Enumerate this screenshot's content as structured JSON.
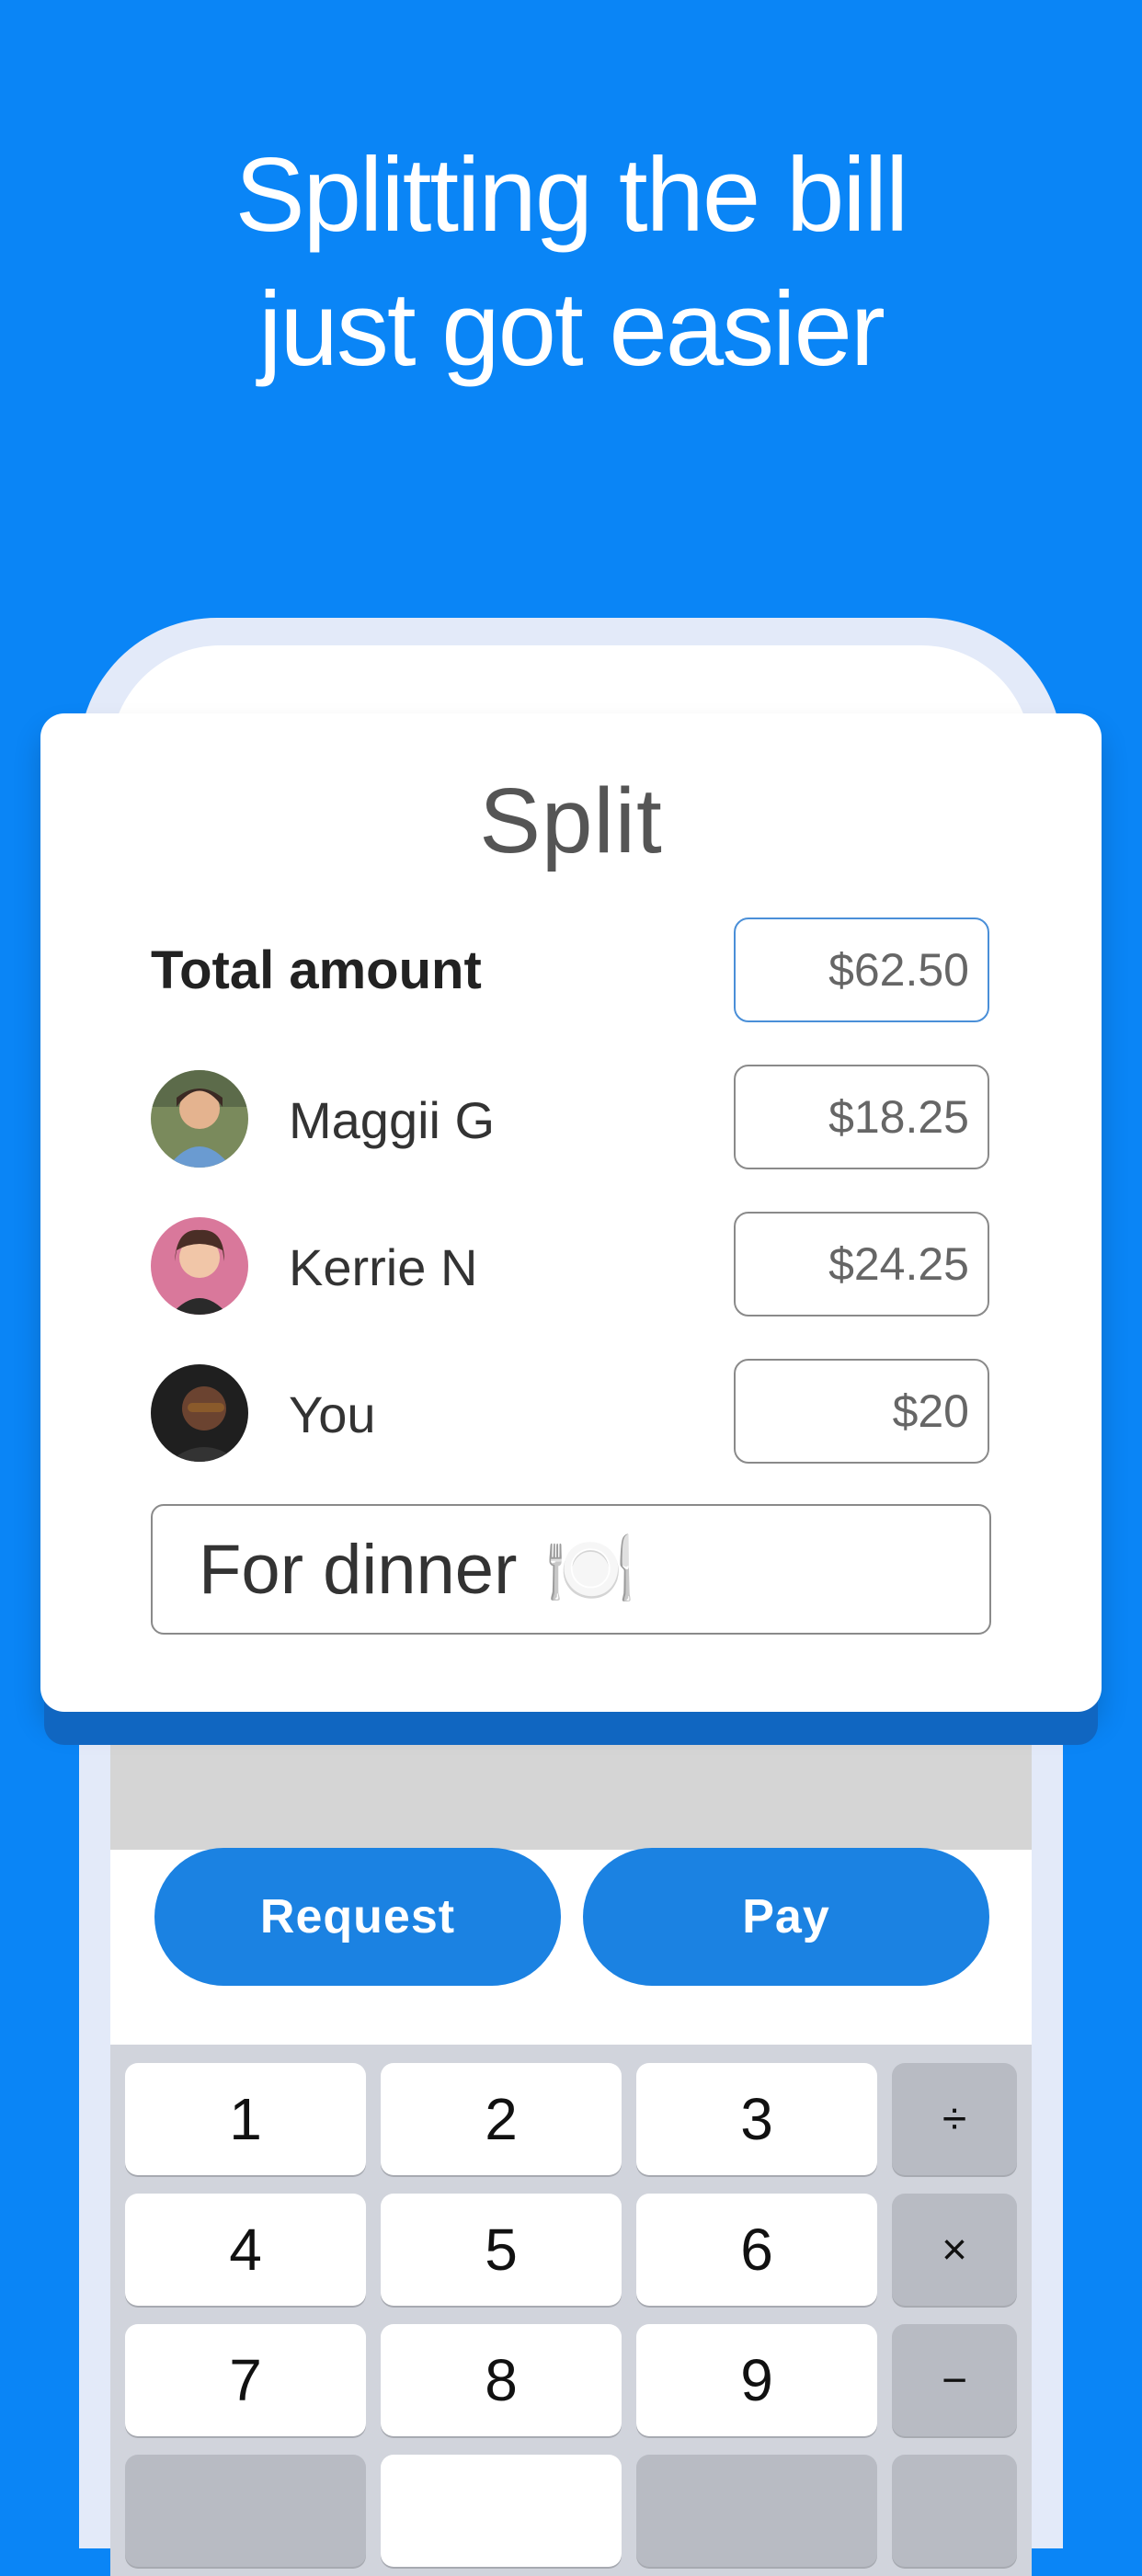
{
  "headline": {
    "line1": "Splitting the bill",
    "line2": "just got easier"
  },
  "card": {
    "title": "Split",
    "total_label": "Total amount",
    "total_value": "$62.50",
    "people": [
      {
        "name": "Maggii G",
        "amount": "$18.25"
      },
      {
        "name": "Kerrie N",
        "amount": "$24.25"
      },
      {
        "name": "You",
        "amount": "$20"
      }
    ],
    "note_text": "For dinner",
    "note_emoji": "🍽️"
  },
  "actions": {
    "request": "Request",
    "pay": "Pay"
  },
  "keypad": {
    "keys": [
      "1",
      "2",
      "3",
      "÷",
      "4",
      "5",
      "6",
      "×",
      "7",
      "8",
      "9",
      "−"
    ]
  },
  "colors": {
    "background": "#0a85f6",
    "button": "#1b82e2"
  }
}
